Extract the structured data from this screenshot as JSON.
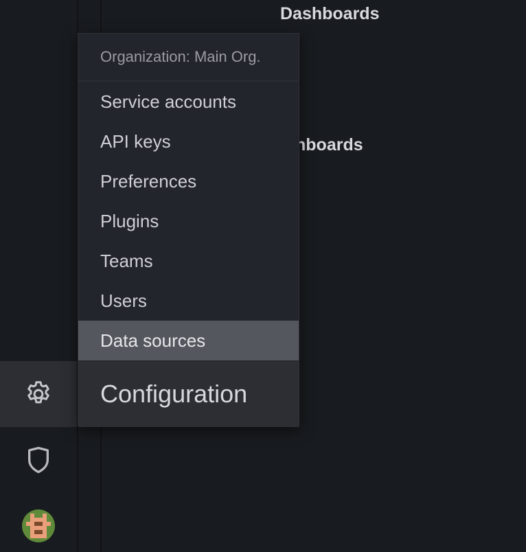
{
  "page": {
    "title": "Dashboards",
    "subtitle_fragment": "nboards"
  },
  "sidemenu": {
    "items": [
      {
        "icon": "gear-icon"
      },
      {
        "icon": "shield-icon"
      },
      {
        "icon": "avatar"
      }
    ]
  },
  "dropdown": {
    "header": "Organization: Main Org.",
    "items": [
      {
        "label": "Service accounts"
      },
      {
        "label": "API keys"
      },
      {
        "label": "Preferences"
      },
      {
        "label": "Plugins"
      },
      {
        "label": "Teams"
      },
      {
        "label": "Users"
      },
      {
        "label": "Data sources"
      }
    ],
    "active_index": 6,
    "footer": "Configuration"
  },
  "colors": {
    "background": "#181b1f",
    "menu_background": "#22252b",
    "active_item": "#55575e",
    "text": "#ced0d6",
    "header_text": "#9b9ca2"
  }
}
